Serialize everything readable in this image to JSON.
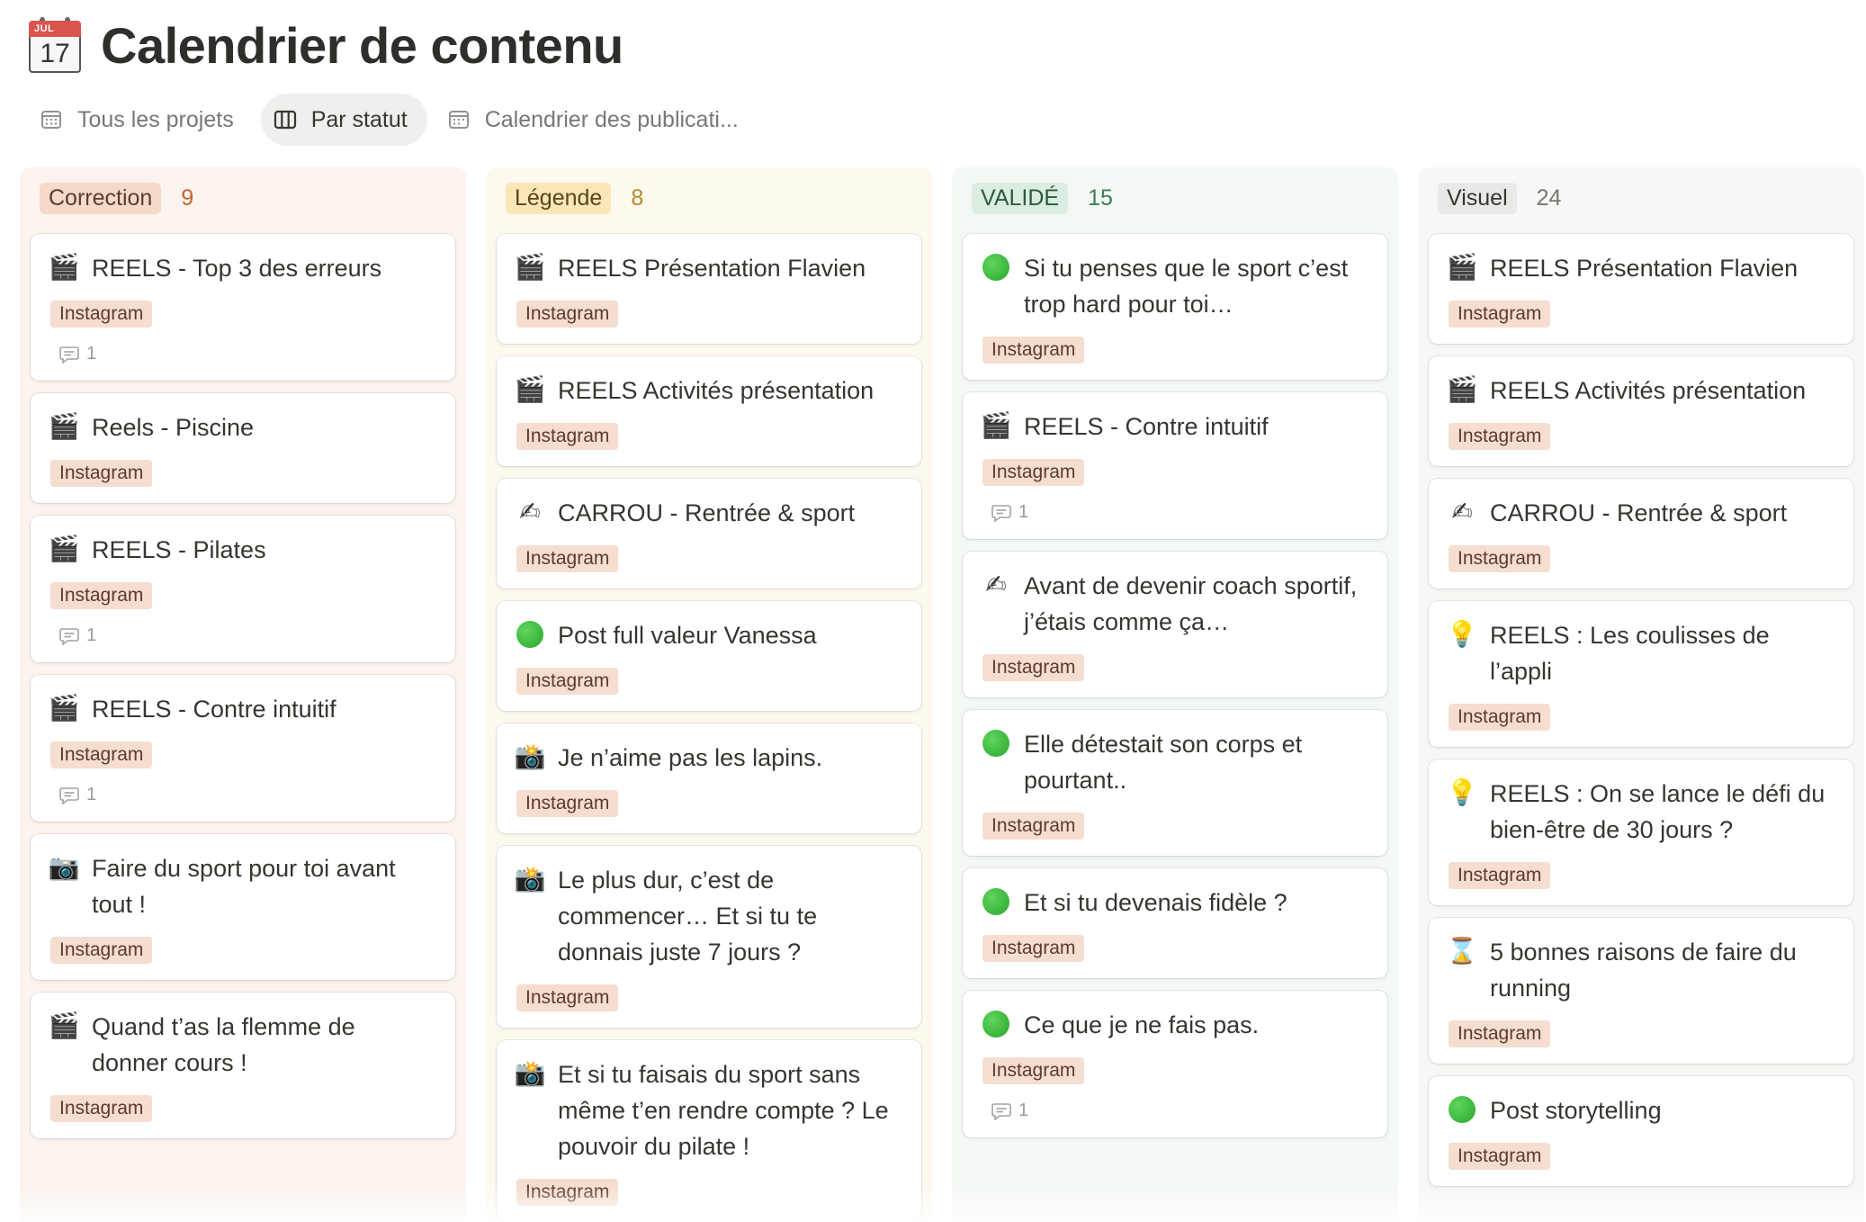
{
  "page": {
    "title": "Calendrier de contenu",
    "icon": "calendar-icon",
    "icon_month": "JUL",
    "icon_day": "17"
  },
  "tabs": [
    {
      "label": "Tous les projets",
      "icon": "table-icon"
    },
    {
      "label": "Par statut",
      "icon": "board-icon",
      "active": true
    },
    {
      "label": "Calendrier des publicati...",
      "icon": "calendar-view-icon"
    }
  ],
  "colors": {
    "correction_bg": "#fbf3ee",
    "correction_pill": "#f5d9c9",
    "correction_text": "#c0642d",
    "legende_bg": "#fdf9ef",
    "legende_pill": "#f9e7b5",
    "legende_text": "#b8882a",
    "valide_bg": "#f4f8f4",
    "valide_pill": "#dbede0",
    "valide_text": "#3f7d55",
    "visuel_bg": "#f7f7f5",
    "visuel_pill": "#e9e9e7",
    "visuel_text": "#787774",
    "tag_bg": "#f5ddd0"
  },
  "columns": [
    {
      "status": "Correction",
      "count": "9",
      "cards": [
        {
          "emoji": "clapper",
          "title": "REELS - Top 3 des erreurs",
          "tag": "Instagram",
          "comments": "1"
        },
        {
          "emoji": "clapper",
          "title": "Reels - Piscine",
          "tag": "Instagram"
        },
        {
          "emoji": "clapper",
          "title": "REELS - Pilates",
          "tag": "Instagram",
          "comments": "1"
        },
        {
          "emoji": "clapper",
          "title": "REELS - Contre intuitif",
          "tag": "Instagram",
          "comments": "1"
        },
        {
          "emoji": "camera",
          "title": "Faire du sport pour toi avant tout !",
          "tag": "Instagram"
        },
        {
          "emoji": "clapper",
          "title": "Quand t’as la flemme de donner cours !",
          "tag": "Instagram"
        }
      ]
    },
    {
      "status": "Légende",
      "count": "8",
      "cards": [
        {
          "emoji": "clapper",
          "title": "REELS Présentation Flavien",
          "tag": "Instagram"
        },
        {
          "emoji": "clapper",
          "title": "REELS Activités présentation",
          "tag": "Instagram"
        },
        {
          "emoji": "writing-hand",
          "title": "CARROU - Rentrée & sport",
          "tag": "Instagram"
        },
        {
          "emoji": "green-circle",
          "title": "Post full valeur Vanessa",
          "tag": "Instagram"
        },
        {
          "emoji": "camera-flash",
          "title": "Je n’aime pas les lapins.",
          "tag": "Instagram"
        },
        {
          "emoji": "camera-flash",
          "title": "Le plus dur, c’est de commencer… Et si tu te donnais juste 7 jours ?",
          "tag": "Instagram"
        },
        {
          "emoji": "camera-flash",
          "title": "Et si tu faisais du sport sans même t’en rendre compte ? Le pouvoir du pilate !",
          "tag": "Instagram"
        }
      ]
    },
    {
      "status": "VALIDÉ",
      "count": "15",
      "cards": [
        {
          "emoji": "green-circle",
          "title": "Si tu penses que le sport c’est trop hard pour toi…",
          "tag": "Instagram"
        },
        {
          "emoji": "clapper",
          "title": "REELS - Contre intuitif",
          "tag": "Instagram",
          "comments": "1"
        },
        {
          "emoji": "writing-hand",
          "title": "Avant de devenir coach sportif, j’étais comme ça…",
          "tag": "Instagram"
        },
        {
          "emoji": "green-circle",
          "title": "Elle détestait son corps et pourtant..",
          "tag": "Instagram"
        },
        {
          "emoji": "green-circle",
          "title": "Et si tu devenais fidèle ?",
          "tag": "Instagram"
        },
        {
          "emoji": "green-circle",
          "title": "Ce que je ne fais pas.",
          "tag": "Instagram",
          "comments": "1"
        }
      ]
    },
    {
      "status": "Visuel",
      "count": "24",
      "cards": [
        {
          "emoji": "clapper",
          "title": "REELS Présentation Flavien",
          "tag": "Instagram"
        },
        {
          "emoji": "clapper",
          "title": "REELS Activités présentation",
          "tag": "Instagram"
        },
        {
          "emoji": "writing-hand",
          "title": "CARROU - Rentrée & sport",
          "tag": "Instagram"
        },
        {
          "emoji": "light-bulb",
          "title": "REELS : Les coulisses de l’appli",
          "tag": "Instagram"
        },
        {
          "emoji": "light-bulb",
          "title": "REELS : On se lance le défi du bien-être de 30 jours ?",
          "tag": "Instagram"
        },
        {
          "emoji": "hourglass",
          "title": "5 bonnes raisons de faire du running",
          "tag": "Instagram"
        },
        {
          "emoji": "green-circle",
          "title": "Post storytelling",
          "tag": "Instagram"
        }
      ]
    }
  ]
}
